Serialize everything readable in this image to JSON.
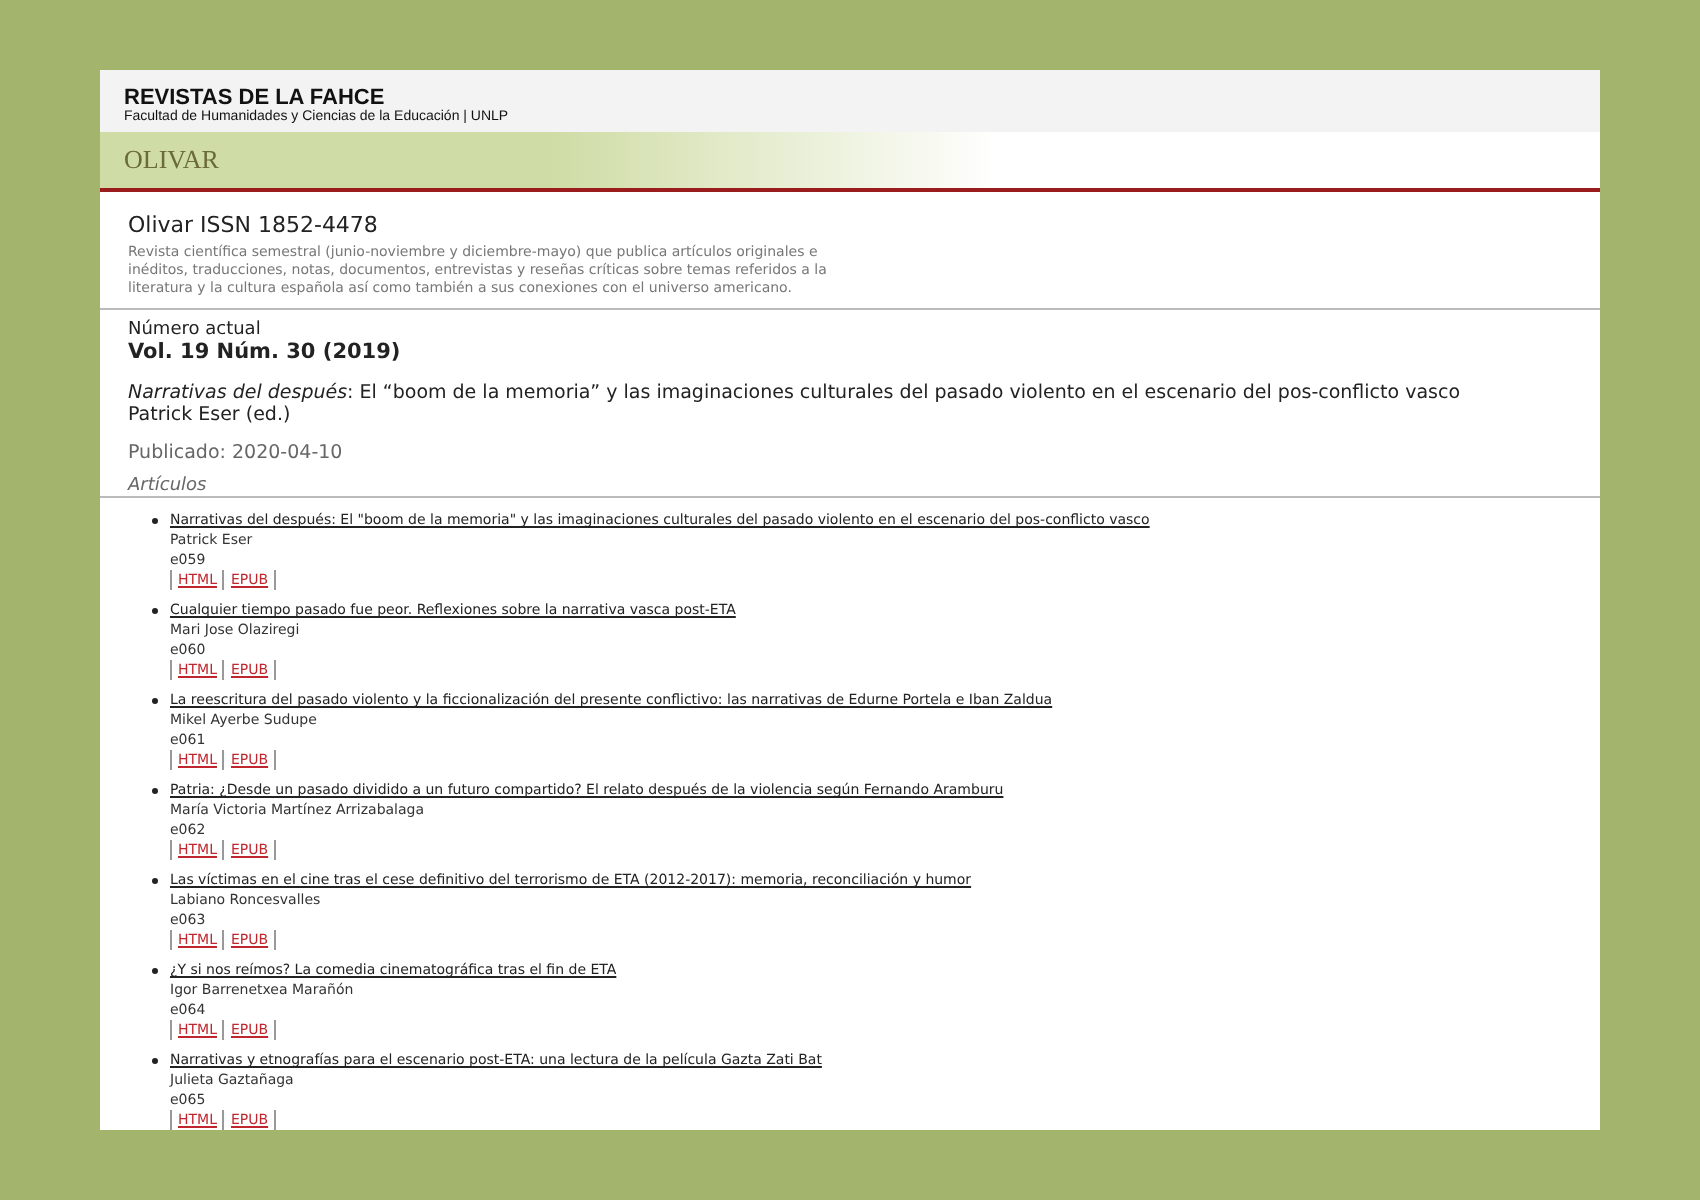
{
  "header": {
    "title": "REVISTAS DE LA FAHCE",
    "subtitle": "Facultad de Humanidades y Ciencias de la Educación | UNLP"
  },
  "banner": {
    "logo": "OLIVAR"
  },
  "journal": {
    "title": "Olivar ISSN 1852-4478",
    "description": "Revista científica semestral (junio-noviembre y diciembre-mayo) que publica artículos originales e inéditos, traducciones, notas, documentos, entrevistas y reseñas críticas sobre temas referidos a la literatura y la cultura española así como también a sus conexiones con el universo americano."
  },
  "issue": {
    "label": "Número actual",
    "volume": "Vol. 19 Núm. 30 (2019)",
    "theme": "*Narrativas del después*: El “boom de la memoria” y las imaginaciones culturales del pasado violento en el escenario del pos-conflicto vasco",
    "editor": "Patrick Eser (ed.)",
    "published": "Publicado: 2020-04-10"
  },
  "section": {
    "title": "Artículos"
  },
  "articles": [
    {
      "title": "Narrativas del después: El \"boom de la memoria\" y las imaginaciones culturales del pasado violento en el escenario del pos-conflicto vasco",
      "author": "Patrick Eser",
      "pages": "e059",
      "links": [
        "HTML",
        "EPUB"
      ]
    },
    {
      "title": "Cualquier tiempo pasado fue peor. Reflexiones sobre la narrativa vasca post-ETA",
      "author": "Mari Jose Olaziregi",
      "pages": "e060",
      "links": [
        "HTML",
        "EPUB"
      ]
    },
    {
      "title": "La reescritura del pasado violento y la ficcionalización del presente conflictivo: las narrativas de Edurne Portela e Iban Zaldua",
      "author": "Mikel Ayerbe Sudupe",
      "pages": "e061",
      "links": [
        "HTML",
        "EPUB"
      ]
    },
    {
      "title": "Patria: ¿Desde un pasado dividido a un futuro compartido? El relato después de la violencia según Fernando Aramburu",
      "author": "María Victoria Martínez Arrizabalaga",
      "pages": "e062",
      "links": [
        "HTML",
        "EPUB"
      ]
    },
    {
      "title": "Las víctimas en el cine tras el cese definitivo del terrorismo de ETA (2012-2017): memoria, reconciliación y humor",
      "author": "Labiano Roncesvalles",
      "pages": "e063",
      "links": [
        "HTML",
        "EPUB"
      ]
    },
    {
      "title": "¿Y si nos reímos? La comedia cinematográfica tras el fin de ETA",
      "author": "Igor Barrenetxea Marañón",
      "pages": "e064",
      "links": [
        "HTML",
        "EPUB"
      ]
    },
    {
      "title": "Narrativas y etnografías para el escenario post-ETA: una lectura de la película Gazta Zati Bat",
      "author": "Julieta Gaztañaga",
      "pages": "e065",
      "links": [
        "HTML",
        "EPUB"
      ]
    }
  ]
}
